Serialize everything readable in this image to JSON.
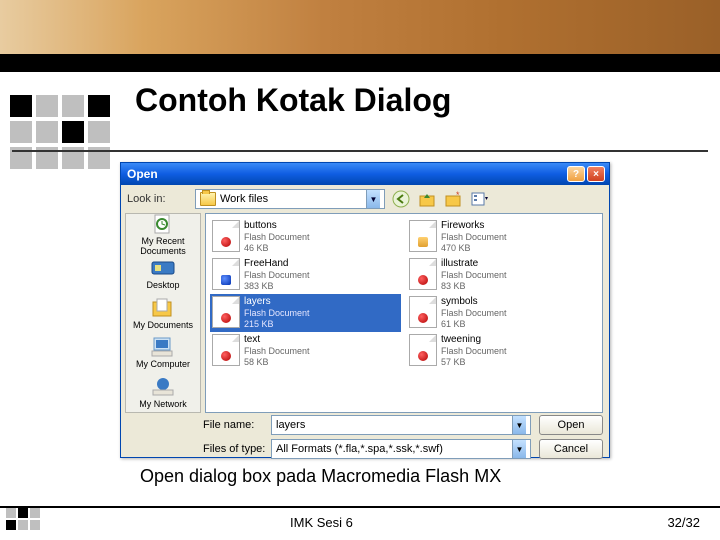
{
  "slide": {
    "title": "Contoh Kotak Dialog",
    "caption": "Open dialog box pada Macromedia Flash MX",
    "footerMeta": "IMK Sesi 6",
    "footerPage": "32/32"
  },
  "dialog": {
    "title": "Open",
    "lookin_label": "Look in:",
    "lookin_value": "Work files",
    "places": [
      {
        "label": "My Recent Documents"
      },
      {
        "label": "Desktop"
      },
      {
        "label": "My Documents"
      },
      {
        "label": "My Computer"
      },
      {
        "label": "My Network"
      }
    ],
    "files": [
      {
        "name": "buttons",
        "type": "Flash Document",
        "size": "46 KB",
        "kind": "fla"
      },
      {
        "name": "Fireworks",
        "type": "Flash Document",
        "size": "470 KB",
        "kind": "fwk"
      },
      {
        "name": "FreeHand",
        "type": "Flash Document",
        "size": "383 KB",
        "kind": "fh"
      },
      {
        "name": "illustrate",
        "type": "Flash Document",
        "size": "83 KB",
        "kind": "fla"
      },
      {
        "name": "layers",
        "type": "Flash Document",
        "size": "215 KB",
        "kind": "fla",
        "selected": true
      },
      {
        "name": "symbols",
        "type": "Flash Document",
        "size": "61 KB",
        "kind": "fla"
      },
      {
        "name": "text",
        "type": "Flash Document",
        "size": "58 KB",
        "kind": "fla"
      },
      {
        "name": "tweening",
        "type": "Flash Document",
        "size": "57 KB",
        "kind": "fla"
      }
    ],
    "filename_label": "File name:",
    "filename_value": "layers",
    "filetype_label": "Files of type:",
    "filetype_value": "All Formats (*.fla,*.spa,*.ssk,*.swf)",
    "open_button": "Open",
    "cancel_button": "Cancel"
  }
}
